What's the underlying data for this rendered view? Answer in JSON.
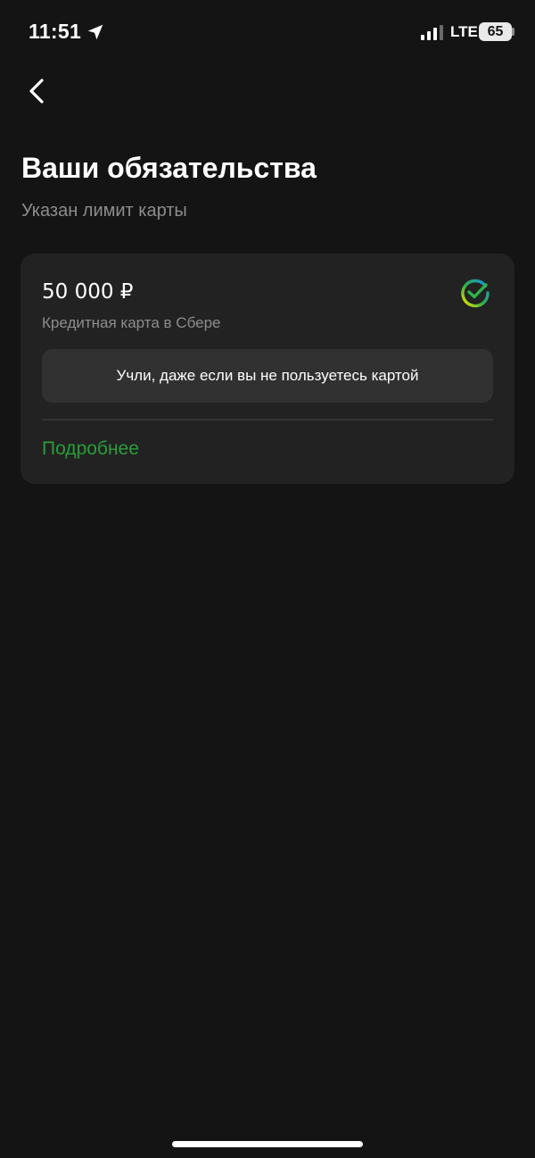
{
  "status_bar": {
    "time": "11:51",
    "network": "LTE",
    "battery": "65",
    "icons": [
      "location-arrow-icon",
      "cellular-signal-icon"
    ]
  },
  "header": {
    "back_icon": "chevron-left-icon",
    "title": "Ваши обязательства",
    "subtitle": "Указан лимит карты"
  },
  "card": {
    "amount": "50 000 ₽",
    "description": "Кредитная карта в Сбере",
    "logo_icon": "sber-logo-icon",
    "notice": "Учли, даже если вы не пользуетесь картой",
    "details_link": "Подробнее"
  },
  "colors": {
    "background": "#141414",
    "card": "#222222",
    "banner": "#313131",
    "accent_green": "#2a9d3a",
    "secondary_text": "#8d8d8d"
  }
}
